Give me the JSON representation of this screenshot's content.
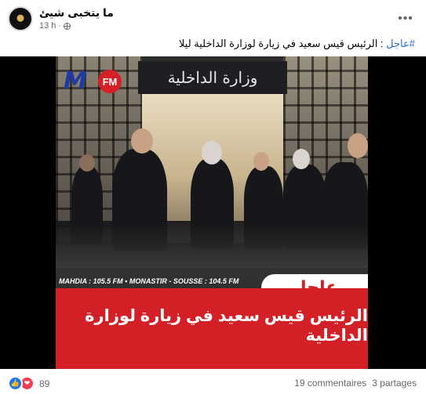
{
  "post": {
    "page_name": "ما يتخبى شيئ",
    "time": "13 h",
    "dot": "·",
    "hashtag": "#عاجل",
    "text": " : الرئيس قيس سعيد في زيارة لوزارة الداخلية ليلا"
  },
  "image": {
    "logo_m": "M",
    "logo_fm": "FM",
    "ministry_sign": "وزارة الداخلية",
    "frequencies": "MAHDIA : 105.5 FM  •  MONASTIR - SOUSSE : 104.5 FM",
    "breaking_label": "عاجل",
    "headline": "الرئيس قيس سعيد في زيارة لوزارة الداخلية"
  },
  "footer": {
    "reaction_count": "89",
    "comments": "19 commentaires",
    "shares": "3 partages"
  },
  "colors": {
    "link_blue": "#216fdb",
    "like_blue": "#1877f2",
    "love_red": "#f33e58",
    "banner_red": "#d31f26"
  },
  "icons": [
    "globe-icon",
    "more-options-icon",
    "like-reaction-icon",
    "love-reaction-icon"
  ]
}
